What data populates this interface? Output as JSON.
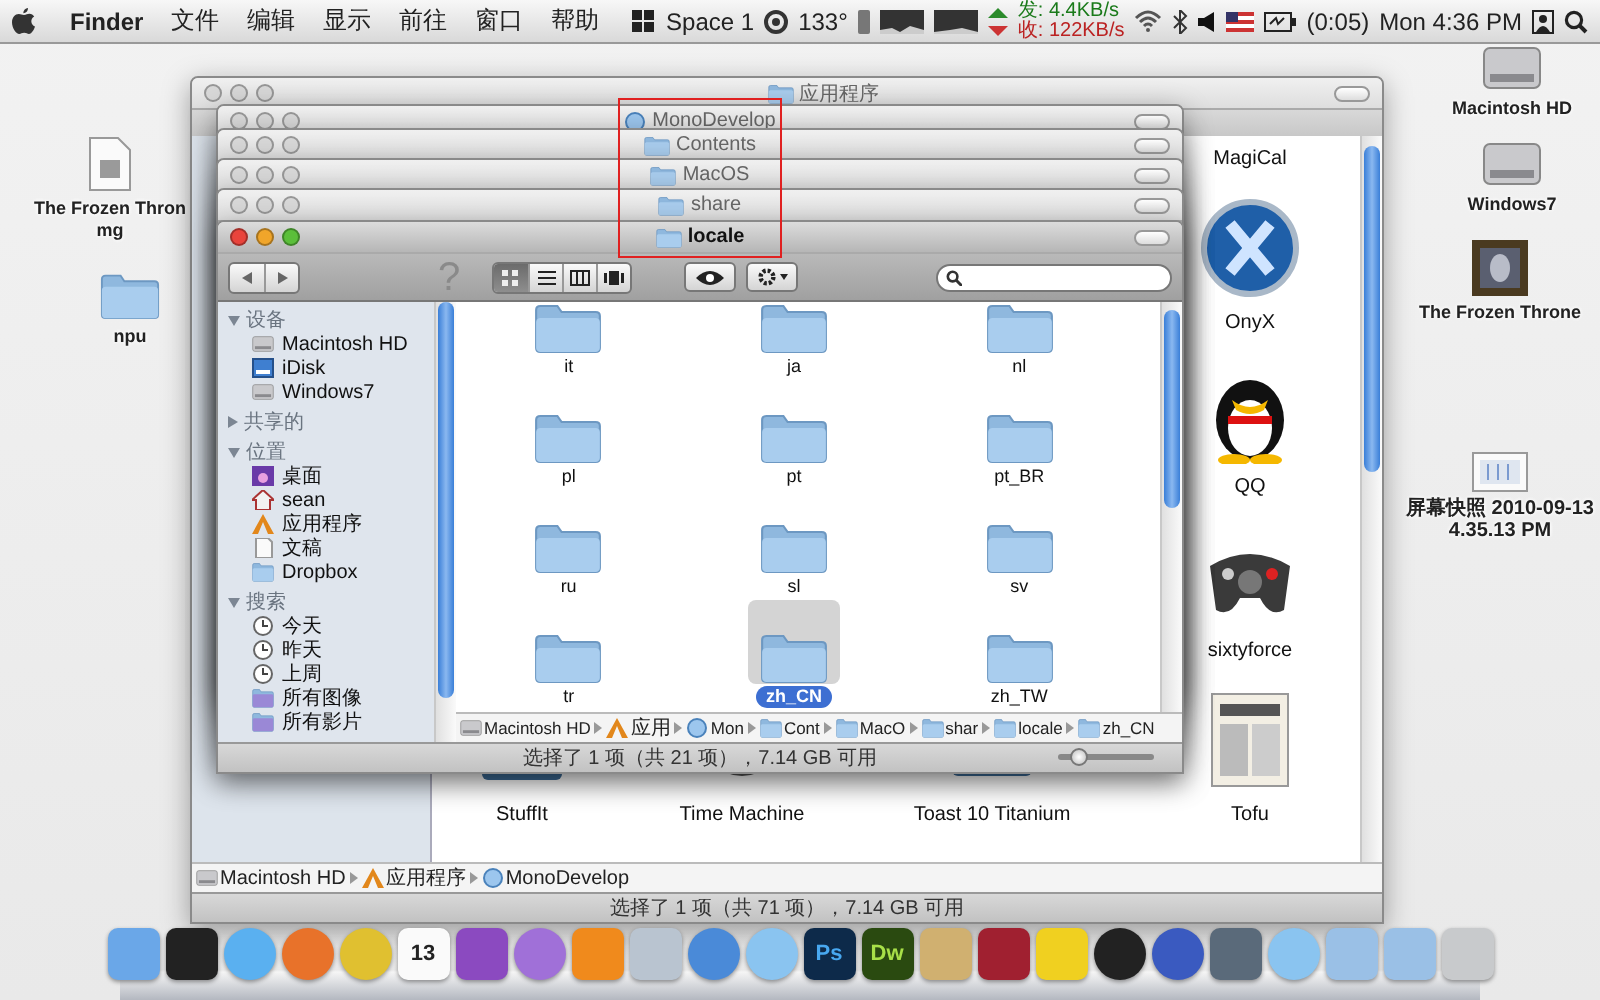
{
  "menu_bar": {
    "app": "Finder",
    "menus": [
      "文件",
      "编辑",
      "显示",
      "前往",
      "窗口",
      "帮助"
    ],
    "status": {
      "space": "Space 1",
      "temperature": "133°",
      "upload_label": "发:",
      "upload": "4.4KB/s",
      "download_label": "收:",
      "download": "122KB/s",
      "battery": "(0:05)",
      "clock": "Mon 4:36 PM"
    }
  },
  "desktop_icons": [
    {
      "label": "The Frozen Thron\nmg",
      "kind": "document"
    },
    {
      "label": "npu",
      "kind": "folder"
    },
    {
      "label": "Macintosh HD",
      "kind": "disk"
    },
    {
      "label": "Windows7",
      "kind": "disk"
    },
    {
      "label": "The Frozen Throne",
      "kind": "game"
    },
    {
      "label": "屏幕快照 2010-09-13\n4.35.13 PM",
      "kind": "screenshot"
    }
  ],
  "back_window": {
    "title": "应用程序",
    "active": false,
    "apps_right": [
      {
        "label": "MagiCal",
        "kind": "label_only"
      },
      {
        "label": "OnyX",
        "kind": "onyx"
      },
      {
        "label": "QQ",
        "kind": "penguin"
      },
      {
        "label": "sixtyforce",
        "kind": "gamepad"
      },
      {
        "label": "Tofu",
        "kind": "newspaper"
      }
    ],
    "apps_bottom": [
      {
        "label": "StuffIt",
        "kind": "box"
      },
      {
        "label": "Time Machine",
        "kind": "clock"
      },
      {
        "label": "Toast 10 Titanium",
        "kind": "disc"
      }
    ],
    "path": [
      {
        "label": "Macintosh HD",
        "kind": "disk"
      },
      {
        "label": "应用程序",
        "kind": "apps"
      },
      {
        "label": "MonoDevelop",
        "kind": "app"
      }
    ],
    "status": "选择了 1 项（共 71 项），7.14 GB 可用"
  },
  "stacked_windows": [
    {
      "title": "MonoDevelop",
      "active": false
    },
    {
      "title": "Contents",
      "active": false
    },
    {
      "title": "MacOS",
      "active": false
    },
    {
      "title": "share",
      "active": false
    }
  ],
  "front_window": {
    "title": "locale",
    "active": true,
    "help": "?",
    "view_modes": [
      {
        "kind": "icon",
        "selected": true
      },
      {
        "kind": "list",
        "selected": false
      },
      {
        "kind": "columns",
        "selected": false
      },
      {
        "kind": "coverflow",
        "selected": false
      }
    ],
    "sidebar": [
      {
        "heading": "设备",
        "expanded": true,
        "items": [
          {
            "label": "Macintosh HD",
            "kind": "disk"
          },
          {
            "label": "iDisk",
            "kind": "idisk"
          },
          {
            "label": "Windows7",
            "kind": "disk"
          }
        ]
      },
      {
        "heading": "共享的",
        "expanded": false
      },
      {
        "heading": "位置",
        "expanded": true,
        "items": [
          {
            "label": "桌面",
            "kind": "desktop"
          },
          {
            "label": "sean",
            "kind": "home"
          },
          {
            "label": "应用程序",
            "kind": "apps"
          },
          {
            "label": "文稿",
            "kind": "docs"
          },
          {
            "label": "Dropbox",
            "kind": "dropbox"
          }
        ]
      },
      {
        "heading": "搜索",
        "expanded": true,
        "items": [
          {
            "label": "今天",
            "kind": "clock"
          },
          {
            "label": "昨天",
            "kind": "clock"
          },
          {
            "label": "上周",
            "kind": "clock"
          },
          {
            "label": "所有图像",
            "kind": "smart"
          },
          {
            "label": "所有影片",
            "kind": "smart"
          }
        ]
      }
    ],
    "folders": [
      {
        "name": "it",
        "selected": false
      },
      {
        "name": "ja",
        "selected": false
      },
      {
        "name": "nl",
        "selected": false
      },
      {
        "name": "pl",
        "selected": false
      },
      {
        "name": "pt",
        "selected": false
      },
      {
        "name": "pt_BR",
        "selected": false
      },
      {
        "name": "ru",
        "selected": false
      },
      {
        "name": "sl",
        "selected": false
      },
      {
        "name": "sv",
        "selected": false
      },
      {
        "name": "tr",
        "selected": false
      },
      {
        "name": "zh_CN",
        "selected": true
      },
      {
        "name": "zh_TW",
        "selected": false
      }
    ],
    "path": [
      {
        "label": "Macintosh HD",
        "kind": "disk"
      },
      {
        "label": "应用",
        "kind": "apps"
      },
      {
        "label": "Mon",
        "kind": "app"
      },
      {
        "label": "Cont",
        "kind": "folder"
      },
      {
        "label": "MacO",
        "kind": "folder"
      },
      {
        "label": "shar",
        "kind": "folder"
      },
      {
        "label": "locale",
        "kind": "folder"
      },
      {
        "label": "zh_CN",
        "kind": "folder"
      }
    ],
    "status": "选择了 1 项（共 21 项），7.14 GB 可用",
    "zoom": {
      "level": 0.2
    }
  },
  "dock": [
    {
      "kind": "finder"
    },
    {
      "kind": "terminal"
    },
    {
      "kind": "safari"
    },
    {
      "kind": "firefox"
    },
    {
      "kind": "chrome"
    },
    {
      "kind": "calendar",
      "text": "13"
    },
    {
      "kind": "purple"
    },
    {
      "kind": "violet"
    },
    {
      "kind": "cone"
    },
    {
      "kind": "preview"
    },
    {
      "kind": "music"
    },
    {
      "kind": "sky"
    },
    {
      "kind": "ps",
      "text": "Ps"
    },
    {
      "kind": "dw",
      "text": "Dw"
    },
    {
      "kind": "photo"
    },
    {
      "kind": "wine"
    },
    {
      "kind": "duck"
    },
    {
      "kind": "penguin"
    },
    {
      "kind": "globe"
    },
    {
      "kind": "camera"
    },
    {
      "kind": "sky"
    },
    {
      "kind": "stack"
    },
    {
      "kind": "stack"
    },
    {
      "kind": "trash"
    }
  ]
}
